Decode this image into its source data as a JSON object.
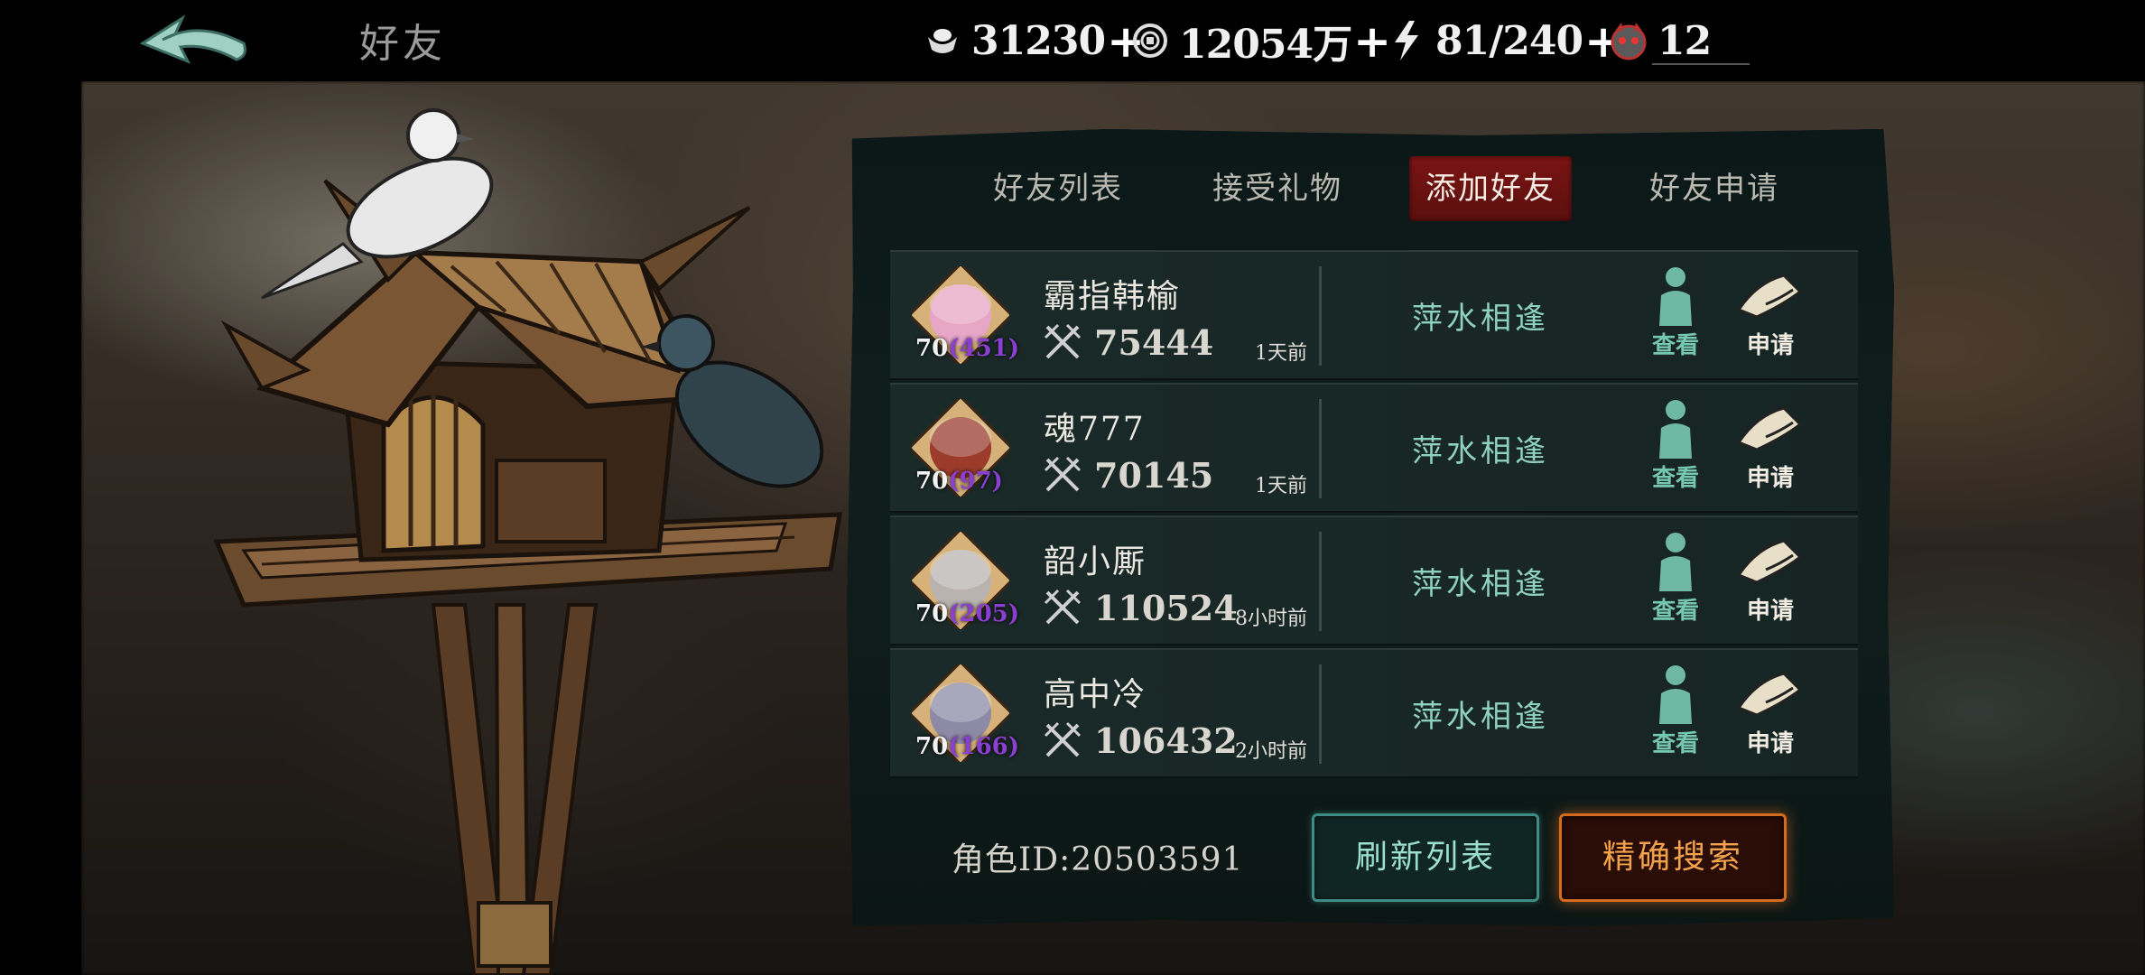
{
  "header": {
    "title": "好友",
    "back_icon": "back-arrow-icon",
    "resources": [
      {
        "icon": "ingot-icon",
        "value": "31230",
        "plus": "+"
      },
      {
        "icon": "coin-icon",
        "value": "12054万",
        "plus": "+"
      },
      {
        "icon": "lightning-icon",
        "value": "81/240",
        "plus": "+"
      },
      {
        "icon": "demon-mask-icon",
        "value": "12",
        "plus": ""
      }
    ]
  },
  "tabs": [
    {
      "label": "好友列表",
      "active": false
    },
    {
      "label": "接受礼物",
      "active": false
    },
    {
      "label": "添加好友",
      "active": true
    },
    {
      "label": "好友申请",
      "active": false
    }
  ],
  "players": [
    {
      "name": "霸指韩榆",
      "level": "70",
      "sub_level": "(451)",
      "power": "75444",
      "ago": "1天前",
      "status": "萍水相逢",
      "avatar_color": "#e7a6c6"
    },
    {
      "name": "魂777",
      "level": "70",
      "sub_level": "(97)",
      "power": "70145",
      "ago": "1天前",
      "status": "萍水相逢",
      "avatar_color": "#9a3b2c"
    },
    {
      "name": "韶小厮",
      "level": "70",
      "sub_level": "(205)",
      "power": "110524",
      "ago": "8小时前",
      "status": "萍水相逢",
      "avatar_color": "#b9b3b0"
    },
    {
      "name": "高中冷",
      "level": "70",
      "sub_level": "(166)",
      "power": "106432",
      "ago": "2小时前",
      "status": "萍水相逢",
      "avatar_color": "#8d8aa6"
    }
  ],
  "row_actions": {
    "view_label": "查看",
    "apply_label": "申请"
  },
  "footer": {
    "role_id": "角色ID:20503591",
    "refresh_label": "刷新列表",
    "search_label": "精确搜索"
  }
}
